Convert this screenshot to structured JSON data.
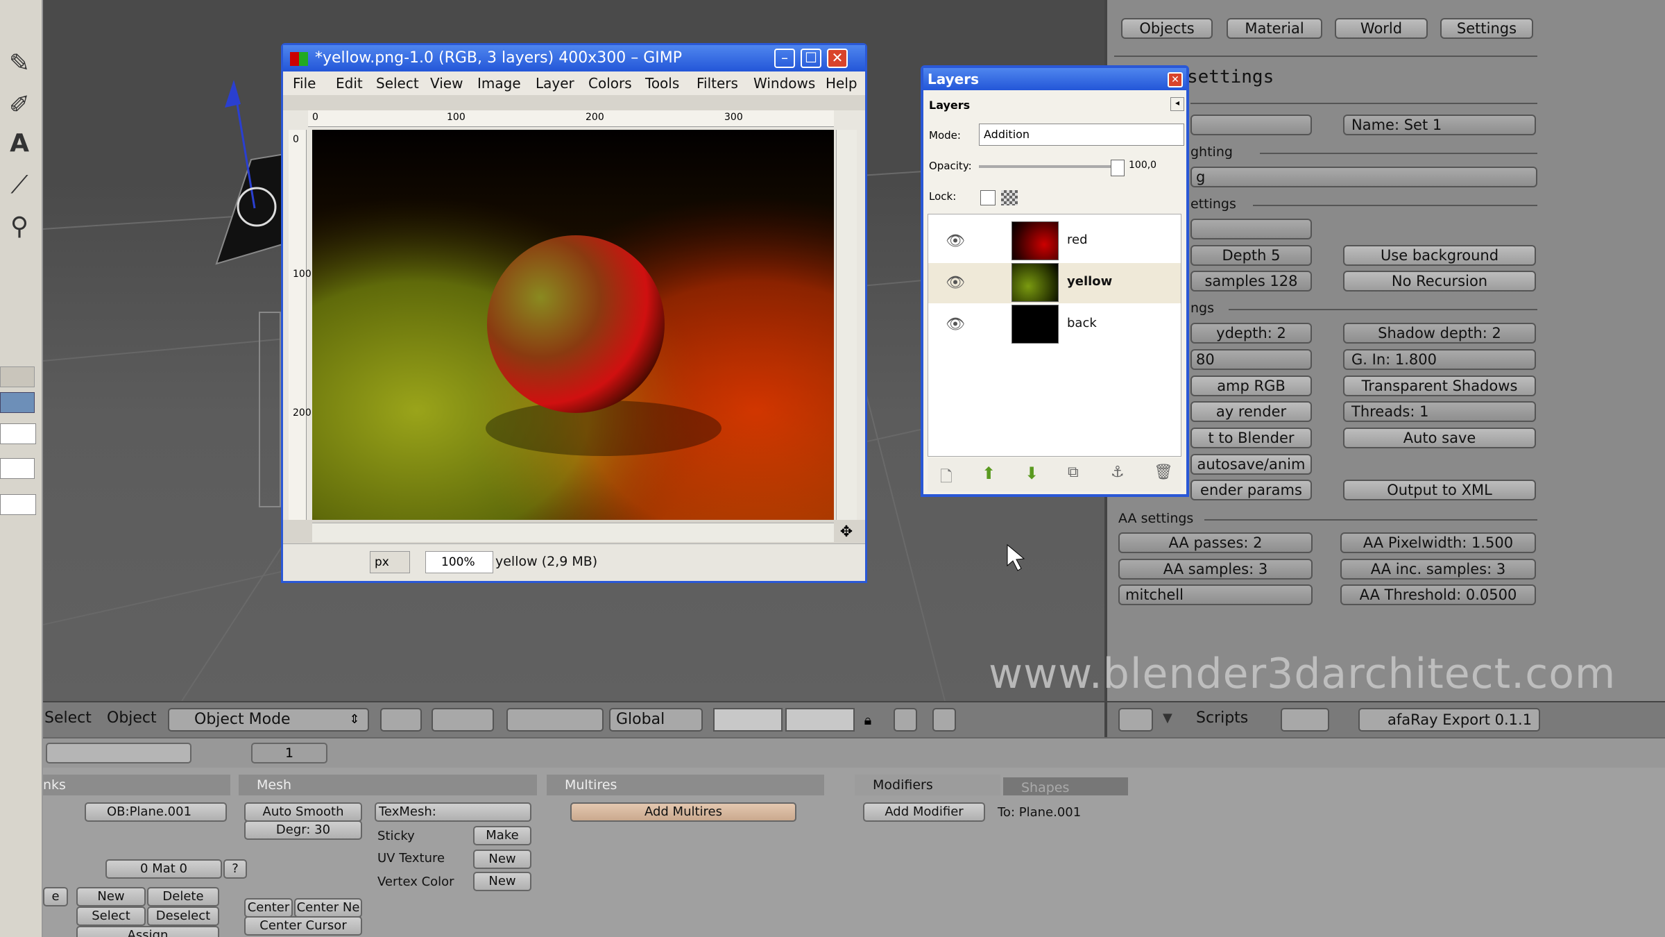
{
  "blender": {
    "right_tabs": [
      "Objects",
      "Material",
      "World",
      "Settings"
    ],
    "panel_title": "settings",
    "name_field": "Name: Set 1",
    "section_lighting": "ghting",
    "lighting_value": "g",
    "section_settings": "ettings",
    "raydepth_label": "Depth 5",
    "samples_label": "samples 128",
    "use_background": "Use background",
    "no_recursion": "No Recursion",
    "section_ngs": "ngs",
    "raydepth2": "ydepth: 2",
    "shadow_depth": "Shadow depth: 2",
    "gamma_value": "80",
    "gamma_in": "G. In: 1.800",
    "clamp_rgb": "amp RGB",
    "transparent_shadows": "Transparent Shadows",
    "ay_render": "ay render",
    "threads": "Threads: 1",
    "to_blender": "t to Blender",
    "auto_save": "Auto save",
    "autosave_anim": "autosave/anim",
    "render_params": "ender params",
    "output_xml": "Output to XML",
    "aa_settings": "AA settings",
    "aa_passes": "AA passes: 2",
    "aa_pixelwidth": "AA Pixelwidth: 1.500",
    "aa_samples": "AA samples: 3",
    "aa_inc_samples": "AA inc. samples: 3",
    "filter": "mitchell",
    "aa_threshold": "AA Threshold: 0.0500",
    "watermark": "www.blender3darchitect.com",
    "header_menu": [
      "Select",
      "Object"
    ],
    "mode": "Object Mode",
    "transform": "Global",
    "scripts": "Scripts",
    "script_name": "afaRay Export 0.1.1",
    "frame": "1",
    "panels": {
      "link_tab": "nks",
      "ob_name": "OB:Plane.001",
      "mat": "0 Mat 0",
      "new": "New",
      "delete": "Delete",
      "select": "Select",
      "deselect": "Deselect",
      "assign": "Assign",
      "mesh_tab": "Mesh",
      "auto_smooth": "Auto Smooth",
      "degr": "Degr: 30",
      "texmesh": "TexMesh:",
      "sticky": "Sticky",
      "make": "Make",
      "uv_texture": "UV Texture",
      "vertex_color": "Vertex Color",
      "new2": "New",
      "center": "Center",
      "center_ne": "Center Ne",
      "center_cursor": "Center Cursor",
      "multires_tab": "Multires",
      "add_multires": "Add Multires",
      "modifiers_tab": "Modifiers",
      "shapes_tab": "Shapes",
      "add_modifier": "Add Modifier",
      "to_plane": "To: Plane.001",
      "e": "e"
    }
  },
  "gimp": {
    "title": "*yellow.png-1.0 (RGB, 3 layers) 400x300 – GIMP",
    "menu": [
      "File",
      "Edit",
      "Select",
      "View",
      "Image",
      "Layer",
      "Colors",
      "Tools",
      "Filters",
      "Windows",
      "Help"
    ],
    "ruler_top": [
      "0",
      "100",
      "200",
      "300"
    ],
    "ruler_left": [
      "0",
      "100",
      "200"
    ],
    "unit": "px",
    "zoom": "100%",
    "status": "yellow (2,9 MB)"
  },
  "layers_dialog": {
    "title": "Layers",
    "subtitle": "Layers",
    "mode_label": "Mode:",
    "mode_value": "Addition",
    "opacity_label": "Opacity:",
    "opacity_value": "100,0",
    "lock_label": "Lock:",
    "layers": [
      {
        "name": "red",
        "color": "#b00000"
      },
      {
        "name": "yellow",
        "color": "#6a8a00"
      },
      {
        "name": "back",
        "color": "#000000"
      }
    ]
  }
}
